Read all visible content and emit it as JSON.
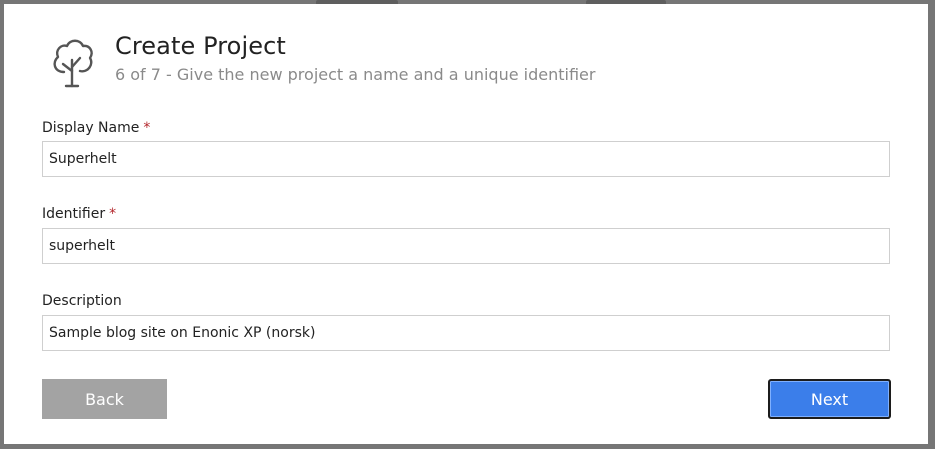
{
  "dialog": {
    "title": "Create Project",
    "subtitle": "6 of 7 - Give the new project a name and a unique identifier"
  },
  "fields": {
    "display_name": {
      "label": "Display Name",
      "required_mark": "*",
      "value": "Superhelt"
    },
    "identifier": {
      "label": "Identifier",
      "required_mark": "*",
      "value": "superhelt"
    },
    "description": {
      "label": "Description",
      "value": "Sample blog site on Enonic XP (norsk)"
    }
  },
  "buttons": {
    "back_label": "Back",
    "next_label": "Next"
  },
  "icons": {
    "logo": "project-tree-icon"
  },
  "colors": {
    "accent": "#3b7eea",
    "required": "#b3262b",
    "back_button": "#a3a3a3"
  }
}
